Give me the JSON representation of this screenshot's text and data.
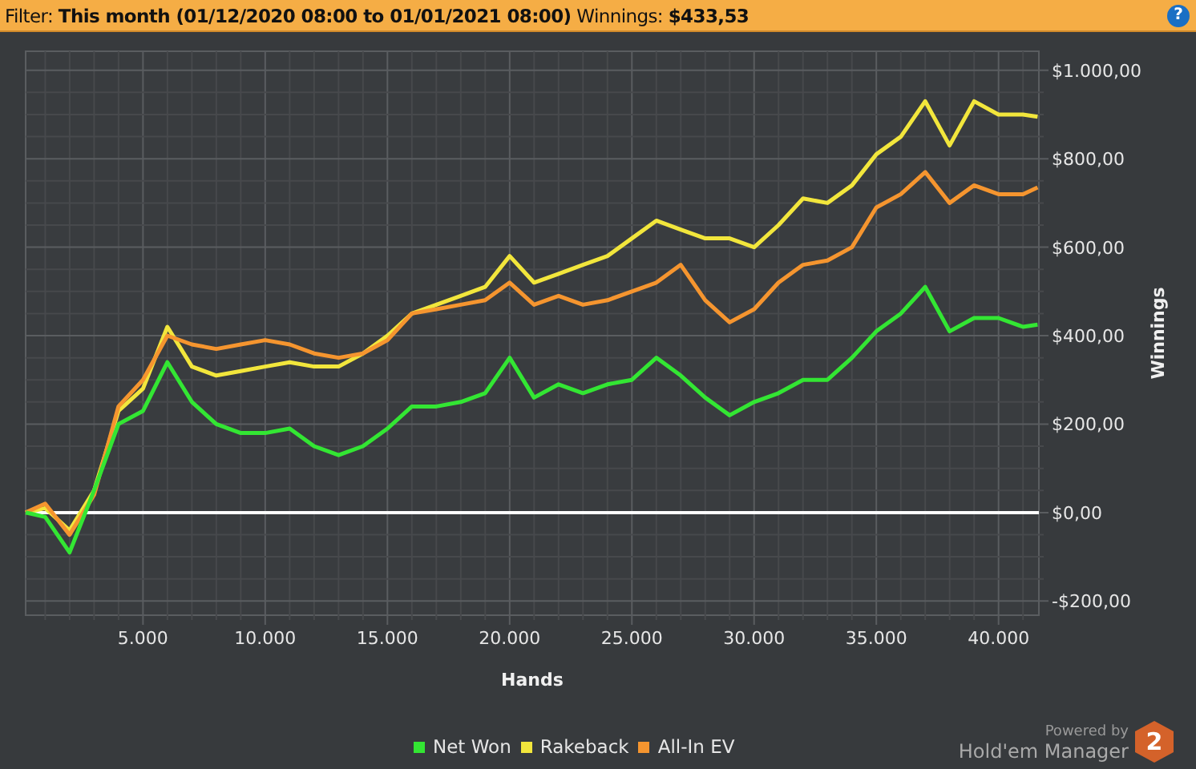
{
  "filter_bar": {
    "text": "Filter: **This month (01/12/2020 08:00 to 01/01/2021 08:00)** Winnings: **$433,53**",
    "help": "?"
  },
  "chart": {
    "chart_data": {
      "type": "line",
      "grid": true,
      "xlabel": "Hands",
      "ylabel": "Winnings",
      "xlim": [
        200,
        41650
      ],
      "ylim": [
        -232,
        1043
      ],
      "xticks": [
        {
          "value": 5000,
          "label": "5.000"
        },
        {
          "value": 10000,
          "label": "10.000"
        },
        {
          "value": 15000,
          "label": "15.000"
        },
        {
          "value": 20000,
          "label": "20.000"
        },
        {
          "value": 25000,
          "label": "25.000"
        },
        {
          "value": 30000,
          "label": "30.000"
        },
        {
          "value": 35000,
          "label": "35.000"
        },
        {
          "value": 40000,
          "label": "40.000"
        }
      ],
      "yticks": [
        {
          "value": 1000,
          "label": "$1.000,00"
        },
        {
          "value": 800,
          "label": "$800,00"
        },
        {
          "value": 600,
          "label": "$600,00"
        },
        {
          "value": 400,
          "label": "$400,00"
        },
        {
          "value": 200,
          "label": "$200,00"
        },
        {
          "value": 0,
          "label": "$0,00"
        },
        {
          "value": -200,
          "label": "-$200,00"
        }
      ],
      "x": [
        200,
        1000,
        2000,
        3000,
        4000,
        5000,
        6000,
        7000,
        8000,
        9000,
        10000,
        11000,
        12000,
        13000,
        14000,
        15000,
        16000,
        17000,
        18000,
        19000,
        20000,
        21000,
        22000,
        23000,
        24000,
        25000,
        26000,
        27000,
        28000,
        29000,
        30000,
        31000,
        32000,
        33000,
        34000,
        35000,
        36000,
        37000,
        38000,
        39000,
        40000,
        41000,
        41600
      ],
      "series": [
        {
          "name": "Net Won",
          "color": "#33e633",
          "values": [
            0,
            -10,
            -90,
            50,
            200,
            230,
            340,
            250,
            200,
            180,
            180,
            190,
            150,
            130,
            150,
            190,
            240,
            240,
            250,
            270,
            350,
            260,
            290,
            270,
            290,
            300,
            350,
            310,
            260,
            220,
            250,
            270,
            300,
            300,
            350,
            410,
            450,
            510,
            410,
            440,
            440,
            420,
            425
          ]
        },
        {
          "name": "Rakeback",
          "color": "#f2e63c",
          "values": [
            0,
            10,
            -40,
            50,
            230,
            280,
            420,
            330,
            310,
            320,
            330,
            340,
            330,
            330,
            360,
            400,
            450,
            470,
            490,
            510,
            580,
            520,
            540,
            560,
            580,
            620,
            660,
            640,
            620,
            620,
            600,
            650,
            710,
            700,
            740,
            810,
            850,
            930,
            830,
            930,
            900,
            900,
            895
          ]
        },
        {
          "name": "All-In EV",
          "color": "#f5952f",
          "values": [
            0,
            20,
            -50,
            40,
            240,
            300,
            400,
            380,
            370,
            380,
            390,
            380,
            360,
            350,
            360,
            390,
            450,
            460,
            470,
            480,
            520,
            470,
            490,
            470,
            480,
            500,
            520,
            560,
            480,
            430,
            460,
            520,
            560,
            570,
            600,
            690,
            720,
            770,
            700,
            740,
            720,
            720,
            735
          ]
        }
      ]
    }
  },
  "branding": {
    "powered_by": "Powered by",
    "product": "Hold'em Manager",
    "logo": "2"
  }
}
